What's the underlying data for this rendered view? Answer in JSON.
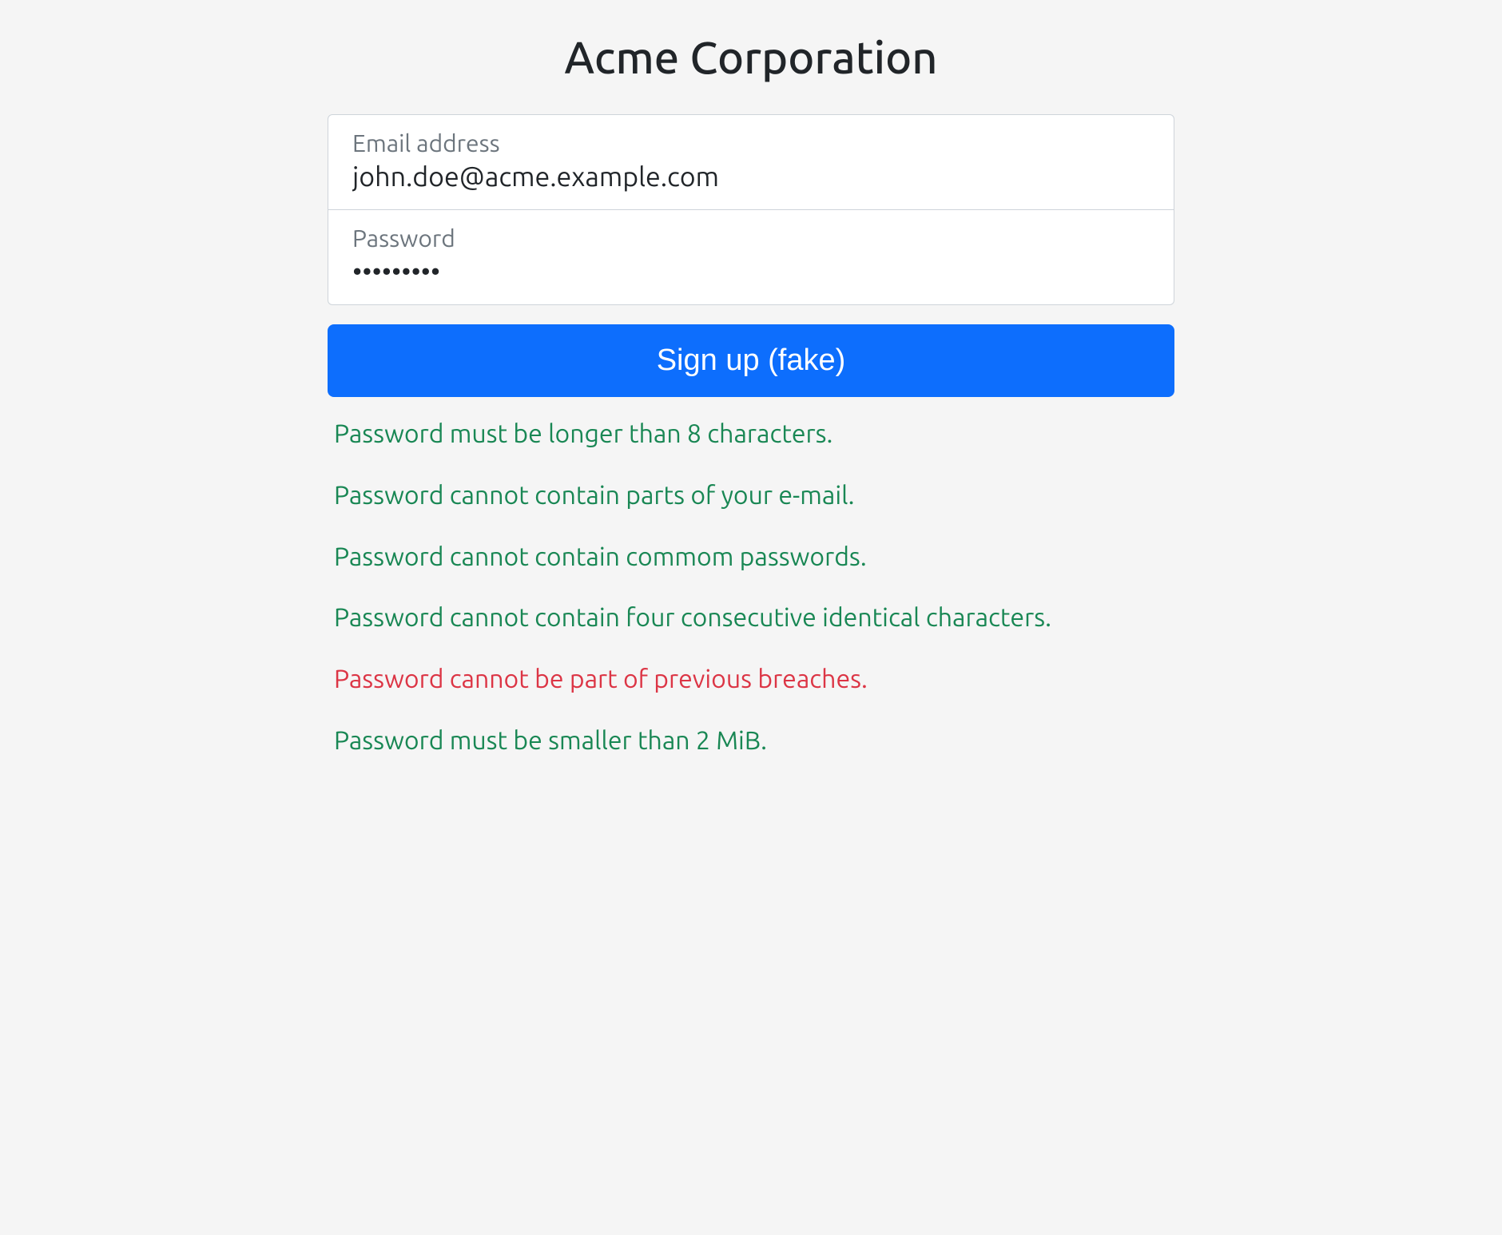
{
  "header": {
    "title": "Acme Corporation"
  },
  "form": {
    "email": {
      "label": "Email address",
      "value": "john.doe@acme.example.com"
    },
    "password": {
      "label": "Password",
      "value": "•••••••••"
    },
    "submit_label": "Sign up (fake)"
  },
  "validations": [
    {
      "text": "Password must be longer than 8 characters.",
      "status": "valid"
    },
    {
      "text": "Password cannot contain parts of your e-mail.",
      "status": "valid"
    },
    {
      "text": "Password cannot contain commom passwords.",
      "status": "valid"
    },
    {
      "text": "Password cannot contain four consecutive identical characters.",
      "status": "valid"
    },
    {
      "text": "Password cannot be part of previous breaches.",
      "status": "invalid"
    },
    {
      "text": "Password must be smaller than 2 MiB.",
      "status": "valid"
    }
  ]
}
